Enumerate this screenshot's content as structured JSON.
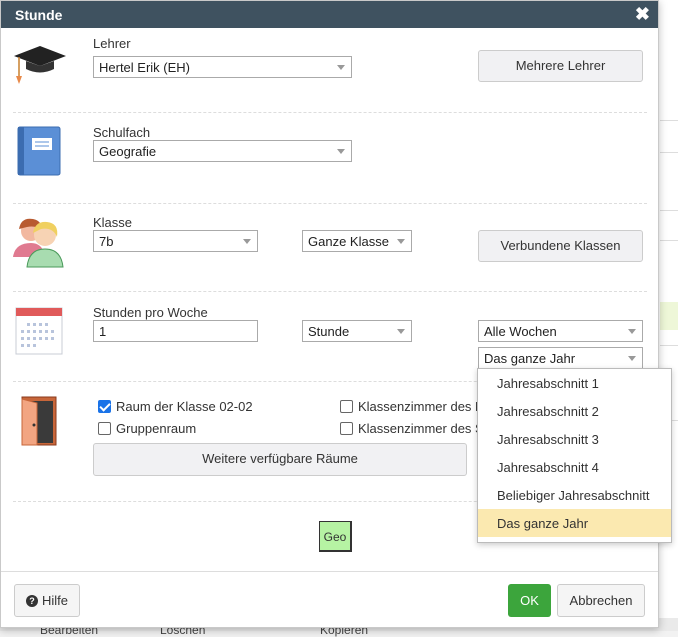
{
  "window": {
    "title": "Stunde",
    "close_glyph": "✖"
  },
  "teacher": {
    "label": "Lehrer",
    "value": "Hertel Erik (EH)",
    "multi_button": "Mehrere Lehrer",
    "icon": "graduation-cap-icon"
  },
  "subject": {
    "label": "Schulfach",
    "value": "Geografie",
    "icon": "book-icon"
  },
  "class": {
    "label": "Klasse",
    "value": "7b",
    "mode": "Ganze Klasse",
    "linked_button": "Verbundene Klassen",
    "icon": "people-icon"
  },
  "hours": {
    "label": "Stunden pro Woche",
    "value": "1",
    "unit": "Stunde",
    "weeks": "Alle Wochen",
    "period": "Das ganze Jahr",
    "icon": "calendar-icon"
  },
  "rooms": {
    "icon": "door-icon",
    "options": [
      {
        "label": "Raum der Klasse 02-02",
        "checked": true
      },
      {
        "label": "Klassenzimmer des L",
        "checked": false
      },
      {
        "label": "Gruppenraum",
        "checked": false
      },
      {
        "label": "Klassenzimmer des S",
        "checked": false
      }
    ],
    "more_button": "Weitere verfügbare Räume"
  },
  "preview": {
    "tile": "Geo",
    "color": "#b6f3a3"
  },
  "footer": {
    "help": "Hilfe",
    "ok": "OK",
    "cancel": "Abbrechen"
  },
  "period_dropdown": {
    "items": [
      "Jahresabschnitt 1",
      "Jahresabschnitt 2",
      "Jahresabschnitt 3",
      "Jahresabschnitt 4",
      "Beliebiger Jahresabschnitt",
      "Das ganze Jahr"
    ],
    "selected_index": 5
  },
  "background": {
    "footer_items": [
      "Bearbeiten",
      "Löschen",
      "Kopieren"
    ]
  },
  "colors": {
    "titlebar": "#3f5260",
    "ok": "#3ca53c",
    "selection": "#fbe9b0"
  }
}
